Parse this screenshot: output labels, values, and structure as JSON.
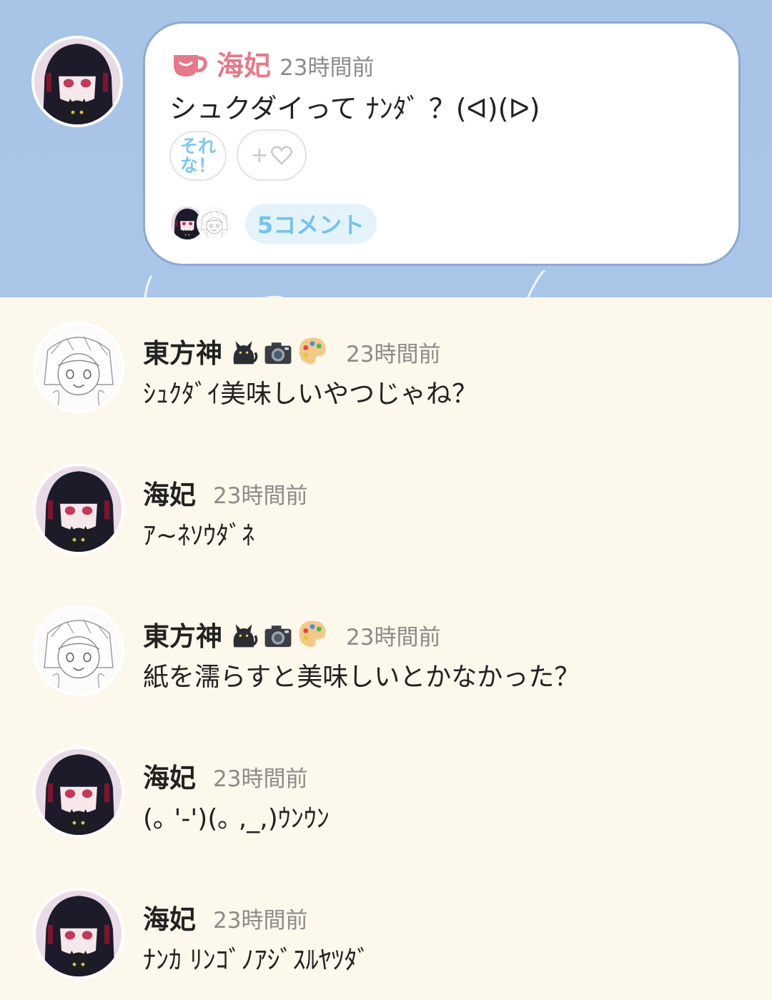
{
  "post": {
    "author": "海妃",
    "time": "23時間前",
    "text": "シュクダイって ﾅﾝﾀﾞ ？(ᐊ)(ᐅ)",
    "reaction_label": "それな！",
    "add_reaction_plus": "+",
    "comment_count_label": "5コメント"
  },
  "comments": [
    {
      "author": "東方神",
      "emoji": [
        "cat-emoji",
        "camera-emoji",
        "palette-emoji"
      ],
      "time": "23時間前",
      "text": "ｼｭｸﾀﾞｲ美味しいやつじゃね？"
    },
    {
      "author": "海妃",
      "time": "23時間前",
      "text": "ｱ~ﾈｿｳﾀﾞﾈ"
    },
    {
      "author": "東方神",
      "emoji": [
        "cat-emoji",
        "camera-emoji",
        "palette-emoji"
      ],
      "time": "23時間前",
      "text": "紙を濡らすと美味しいとかなかった？"
    },
    {
      "author": "海妃",
      "time": "23時間前",
      "text": "(｡ '-')(｡ ,_,)ｳﾝｳﾝ"
    },
    {
      "author": "海妃",
      "time": "23時間前",
      "text": "ﾅﾝｶ ﾘﾝｺﾞﾉｱｼﾞｽﾙﾔﾂﾀﾞ"
    }
  ],
  "colors": {
    "header_bg": "#a9c6e8",
    "page_bg": "#fdf8ec",
    "post_author": "#e47a8a",
    "accent_blue": "#76c2ea",
    "card_border": "#8fa9cf"
  }
}
